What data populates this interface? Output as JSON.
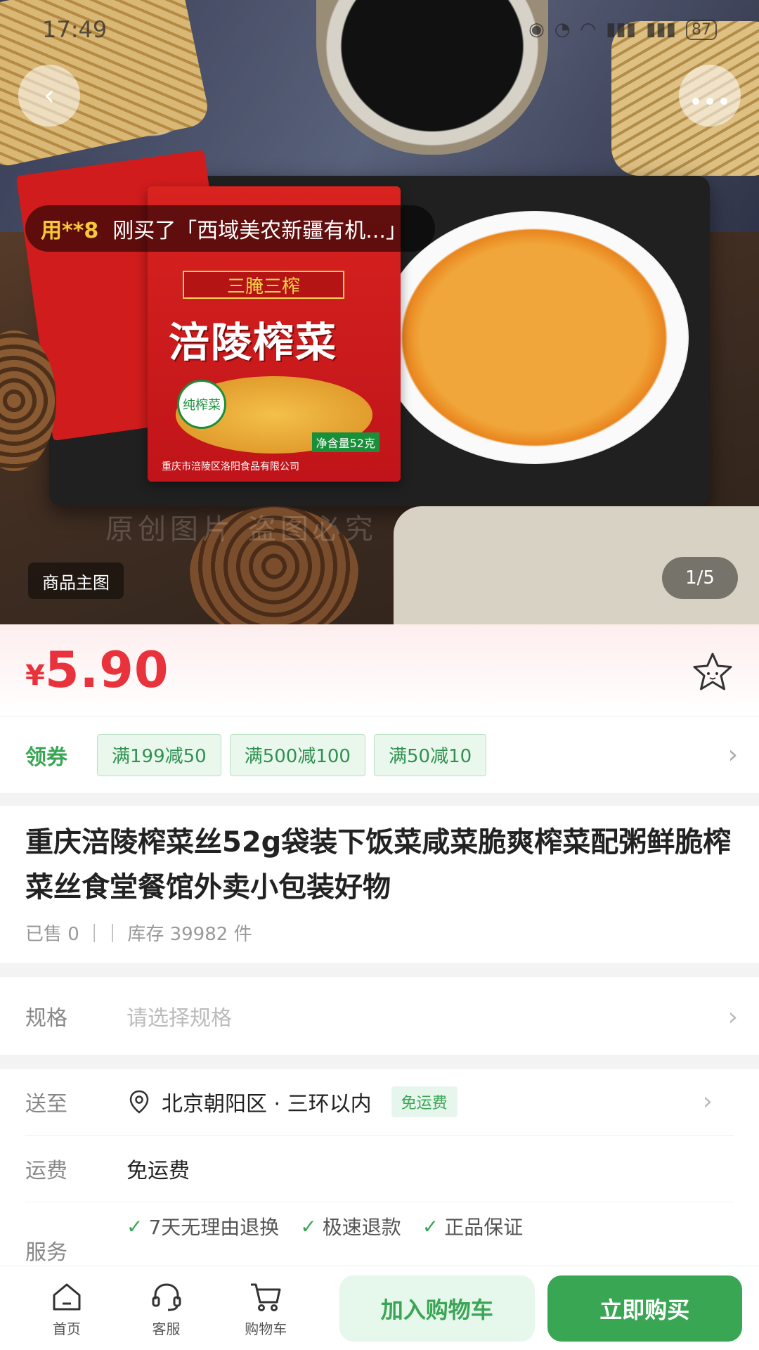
{
  "status_bar": {
    "time": "17:49",
    "battery": "87"
  },
  "hero": {
    "package_band": "三腌三榨",
    "package_brand": "涪陵榨菜",
    "package_tag": "纯榨菜",
    "package_weight": "净含量52克",
    "package_maker": "重庆市涪陵区洛阳食品有限公司",
    "watermark": "原创图片 盗图必究",
    "ticker_user": "用**8",
    "ticker_text": "刚买了「西域美农新疆有机...」",
    "image_label": "商品主图",
    "pager": "1/5"
  },
  "price": {
    "currency": "¥",
    "amount": "5.90"
  },
  "coupons": {
    "label": "领券",
    "items": [
      "满199减50",
      "满500减100",
      "满50减10"
    ]
  },
  "product": {
    "title": "重庆涪陵榨菜丝52g袋装下饭菜咸菜脆爽榨菜配粥鲜脆榨菜丝食堂餐馆外卖小包装好物",
    "meta": "已售 0 ｜｜ 库存 39982 件"
  },
  "spec": {
    "label": "规格",
    "placeholder": "请选择规格"
  },
  "shipping": {
    "to_label": "送至",
    "address": "北京朝阳区 · 三环以内",
    "free_tag": "免运费",
    "fee_label": "运费",
    "fee_value": "免运费",
    "service_label": "服务",
    "services": [
      "7天无理由退换",
      "极速退款",
      "正品保证"
    ]
  },
  "bottom_bar": {
    "home": "首页",
    "service": "客服",
    "cart": "购物车",
    "add_to_cart": "加入购物车",
    "buy_now": "立即购买"
  },
  "colors": {
    "accent_green": "#38a653",
    "price_red": "#e8323c"
  }
}
